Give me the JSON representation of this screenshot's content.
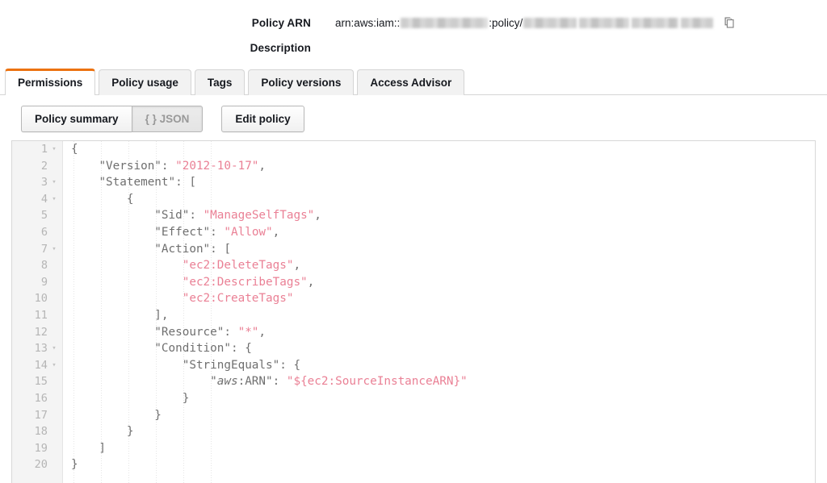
{
  "details": {
    "arn": {
      "label": "Policy ARN",
      "prefix": "arn:aws:iam::",
      "mid": ":policy/",
      "copy_icon": "copy-icon"
    },
    "description": {
      "label": "Description",
      "value": ""
    }
  },
  "tabs": [
    {
      "label": "Permissions",
      "active": true
    },
    {
      "label": "Policy usage",
      "active": false
    },
    {
      "label": "Tags",
      "active": false
    },
    {
      "label": "Policy versions",
      "active": false
    },
    {
      "label": "Access Advisor",
      "active": false
    }
  ],
  "toolbar": {
    "policy_summary_label": "Policy summary",
    "json_label": "{ } JSON",
    "edit_policy_label": "Edit policy"
  },
  "editor": {
    "line_numbers": [
      "1",
      "2",
      "3",
      "4",
      "5",
      "6",
      "7",
      "8",
      "9",
      "10",
      "11",
      "12",
      "13",
      "14",
      "15",
      "16",
      "17",
      "18",
      "19",
      "20"
    ],
    "fold_lines": [
      1,
      3,
      4,
      7,
      13,
      14
    ],
    "lines": [
      "{",
      "    \"Version\": \"2012-10-17\",",
      "    \"Statement\": [",
      "        {",
      "            \"Sid\": \"ManageSelfTags\",",
      "            \"Effect\": \"Allow\",",
      "            \"Action\": [",
      "                \"ec2:DeleteTags\",",
      "                \"ec2:DescribeTags\",",
      "                \"ec2:CreateTags\"",
      "            ],",
      "            \"Resource\": \"*\",",
      "            \"Condition\": {",
      "                \"StringEquals\": {",
      "                    \"aws:ARN\": \"${ec2:SourceInstanceARN}\"",
      "                }",
      "            }",
      "        }",
      "    ]",
      "}"
    ]
  },
  "colors": {
    "accent": "#ec7211",
    "string": "#ea8095",
    "code_text": "#6f6f6f",
    "gutter_bg": "#f4f4f4",
    "line_number": "#b5b5b5"
  }
}
